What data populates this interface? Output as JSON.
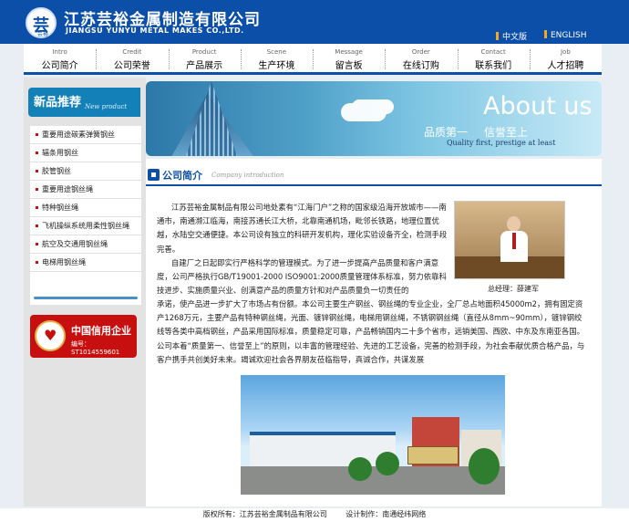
{
  "header": {
    "logo_glyph": "芸",
    "logo_sub": "芸裕",
    "company_cn": "江苏芸裕金属制造有限公司",
    "company_en": "JIANGSU YUNYU METAL MAKES CO.,LTD.",
    "lang_cn": "中文版",
    "lang_en": "ENGLISH"
  },
  "nav": [
    {
      "en": "Intro",
      "cn": "公司简介"
    },
    {
      "en": "Credit",
      "cn": "公司荣誉"
    },
    {
      "en": "Product",
      "cn": "产品展示"
    },
    {
      "en": "Scene",
      "cn": "生产环境"
    },
    {
      "en": "Message",
      "cn": "留言板"
    },
    {
      "en": "Order",
      "cn": "在线订购"
    },
    {
      "en": "Contact",
      "cn": "联系我们"
    },
    {
      "en": "Job",
      "cn": "人才招聘"
    }
  ],
  "sidebar": {
    "title": "新品推荐",
    "title_en": "New product",
    "items": [
      "重要用途碳素弹簧钢丝",
      "辐条用钢丝",
      "胶管钢丝",
      "重要用途钢丝绳",
      "特种钢丝绳",
      "飞机操纵系统用柔性钢丝绳",
      "航空及交通用钢丝绳",
      "电梯用钢丝绳"
    ],
    "credit_title": "中国信用企业",
    "credit_no": "编号：ST1014559601"
  },
  "banner": {
    "about": "About us",
    "slogan_1": "品质第一",
    "slogan_2": "信誉至上",
    "slogan_en": "Quality first, prestige at least"
  },
  "main": {
    "section_title": "公司简介",
    "section_en": "Company introduction",
    "para1": "江苏芸裕金属制品有限公司地处素有“江海门户”之称的国家级沿海开放城市——南通市，南通濒江临海，南接苏通长江大桥，北靠南通机场，毗邻长铁路，地理位置优越，水陆空交通便捷。本公司设有独立的科研开发机构，理化实验设备齐全，检测手段完善。",
    "para2": "自建厂之日起即实行严格科学的管理模式。为了进一步提高产品质量和客户满意度，公司严格执行GB/T19001-2000 ISO9001:2000质量管理体系标准，努力依靠科技进步、实施质量兴业、创满意产品的质量方针和对产品质量负一切责任的",
    "para3": "承诺，使产品进一步扩大了市场占有份额。本公司主要生产钢丝、钢丝绳的专业企业，全厂总占地面积45000m2，拥有固定资产1268万元，主要产品有特种钢丝绳，光面、镀锌钢丝绳，电梯用钢丝绳，不锈钢钢丝绳（直径从8mm~90mm），镀锌钢绞线等各类中高档钢丝，产品采用国际标准，质量稳定可靠，产品畅销国内二十多个省市，远销美国、西欧、中东及东南亚各国。公司本着“质量第一、信誉至上”的原则，以丰富的管理经验、先进的工艺设备，完善的检测手段，为社会奉献优质合格产品，与客户携手共创美好未来。竭诚欢迎社会各界朋友莅临指导，真诚合作，共谋发展",
    "caption": "总经理：薛建军"
  },
  "footer": {
    "copyright": "版权所有：江苏芸裕金属制品有限公司",
    "design": "设计制作：南通经纬网络"
  }
}
